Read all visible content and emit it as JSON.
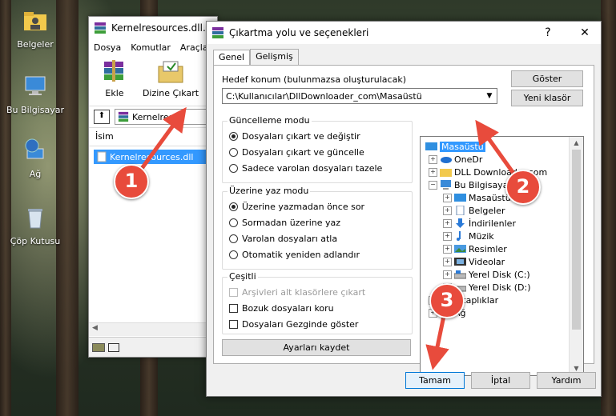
{
  "desktop": {
    "icons": [
      {
        "label": "Belgeler",
        "icon": "folder-user-icon"
      },
      {
        "label": "Bu Bilgisayar",
        "icon": "computer-icon"
      },
      {
        "label": "Ağ",
        "icon": "network-globe-icon"
      },
      {
        "label": "Çöp Kutusu",
        "icon": "recycle-bin-icon"
      }
    ]
  },
  "bg_window": {
    "title": "Kernelresources.dll.z",
    "menu": [
      "Dosya",
      "Komutlar",
      "Araçla"
    ],
    "toolbar": {
      "add_label": "Ekle",
      "extract_label": "Dizine Çıkart"
    },
    "path": "Kernelresou",
    "list_header": "İsim",
    "selected_file": "Kernelresources.dll"
  },
  "dialog": {
    "title": "Çıkartma yolu ve seçenekleri",
    "help_btn": "?",
    "close_btn": "✕",
    "tabs": [
      "Genel",
      "Gelişmiş"
    ],
    "dest_label": "Hedef konum (bulunmazsa oluşturulacak)",
    "dest_value": "C:\\Kullanıcılar\\DllDownloader_com\\Masaüstü",
    "show_btn": "Göster",
    "new_folder_btn": "Yeni klasör",
    "update_mode": {
      "title": "Güncelleme modu",
      "options": [
        "Dosyaları çıkart ve değiştir",
        "Dosyaları çıkart ve güncelle",
        "Sadece varolan dosyaları tazele"
      ],
      "selected": 0
    },
    "overwrite_mode": {
      "title": "Üzerine yaz modu",
      "options": [
        "Üzerine yazmadan önce sor",
        "Sormadan üzerine yaz",
        "Varolan dosyaları atla",
        "Otomatik yeniden adlandır"
      ],
      "selected": 0
    },
    "misc": {
      "title": "Çeşitli",
      "options": [
        "Arşivleri alt klasörlere çıkart",
        "Bozuk dosyaları koru",
        "Dosyaları Gezginde göster"
      ]
    },
    "save_btn": "Ayarları kaydet",
    "tree": [
      {
        "label": "Masaüstü",
        "level": 0,
        "selected": true,
        "icon": "desktop-icon",
        "exp": ""
      },
      {
        "label": "OneDr",
        "level": 1,
        "icon": "cloud-icon",
        "exp": "+"
      },
      {
        "label": "DLL Downloader.com",
        "level": 1,
        "icon": "folder-user-icon",
        "exp": "+"
      },
      {
        "label": "Bu Bilgisayar",
        "level": 1,
        "icon": "computer-icon",
        "exp": "−"
      },
      {
        "label": "Masaüstü",
        "level": 2,
        "icon": "desktop-icon",
        "exp": "+"
      },
      {
        "label": "Belgeler",
        "level": 2,
        "icon": "documents-icon",
        "exp": "+"
      },
      {
        "label": "İndirilenler",
        "level": 2,
        "icon": "download-icon",
        "exp": "+"
      },
      {
        "label": "Müzik",
        "level": 2,
        "icon": "music-icon",
        "exp": "+"
      },
      {
        "label": "Resimler",
        "level": 2,
        "icon": "pictures-icon",
        "exp": "+"
      },
      {
        "label": "Videolar",
        "level": 2,
        "icon": "videos-icon",
        "exp": "+"
      },
      {
        "label": "Yerel Disk (C:)",
        "level": 2,
        "icon": "drive-icon",
        "exp": "+"
      },
      {
        "label": "Yerel Disk (D:)",
        "level": 2,
        "icon": "drive-icon",
        "exp": "+"
      },
      {
        "label": "Kitaplıklar",
        "level": 1,
        "icon": "library-icon",
        "exp": "+"
      },
      {
        "label": "Ağ",
        "level": 1,
        "icon": "network-icon",
        "exp": "+"
      }
    ],
    "ok_btn": "Tamam",
    "cancel_btn": "İptal",
    "help_button": "Yardım"
  },
  "markers": [
    "1",
    "2",
    "3"
  ],
  "colors": {
    "selection": "#3399ff",
    "marker": "#e84b3c"
  }
}
